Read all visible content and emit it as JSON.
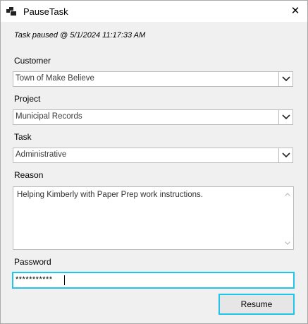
{
  "window": {
    "title": "PauseTask",
    "close_icon": "close-icon"
  },
  "status": "Task paused @ 5/1/2024 11:17:33 AM",
  "customer": {
    "label": "Customer",
    "value": "Town of Make Believe"
  },
  "project": {
    "label": "Project",
    "value": "Municipal Records"
  },
  "task": {
    "label": "Task",
    "value": "Administrative"
  },
  "reason": {
    "label": "Reason",
    "value": "Helping Kimberly with Paper Prep work instructions."
  },
  "password": {
    "label": "Password",
    "value": "***********"
  },
  "buttons": {
    "resume": "Resume"
  },
  "colors": {
    "focus": "#21c5e9",
    "window_bg": "#f0f0f0",
    "field_border": "#bcbcbc"
  }
}
